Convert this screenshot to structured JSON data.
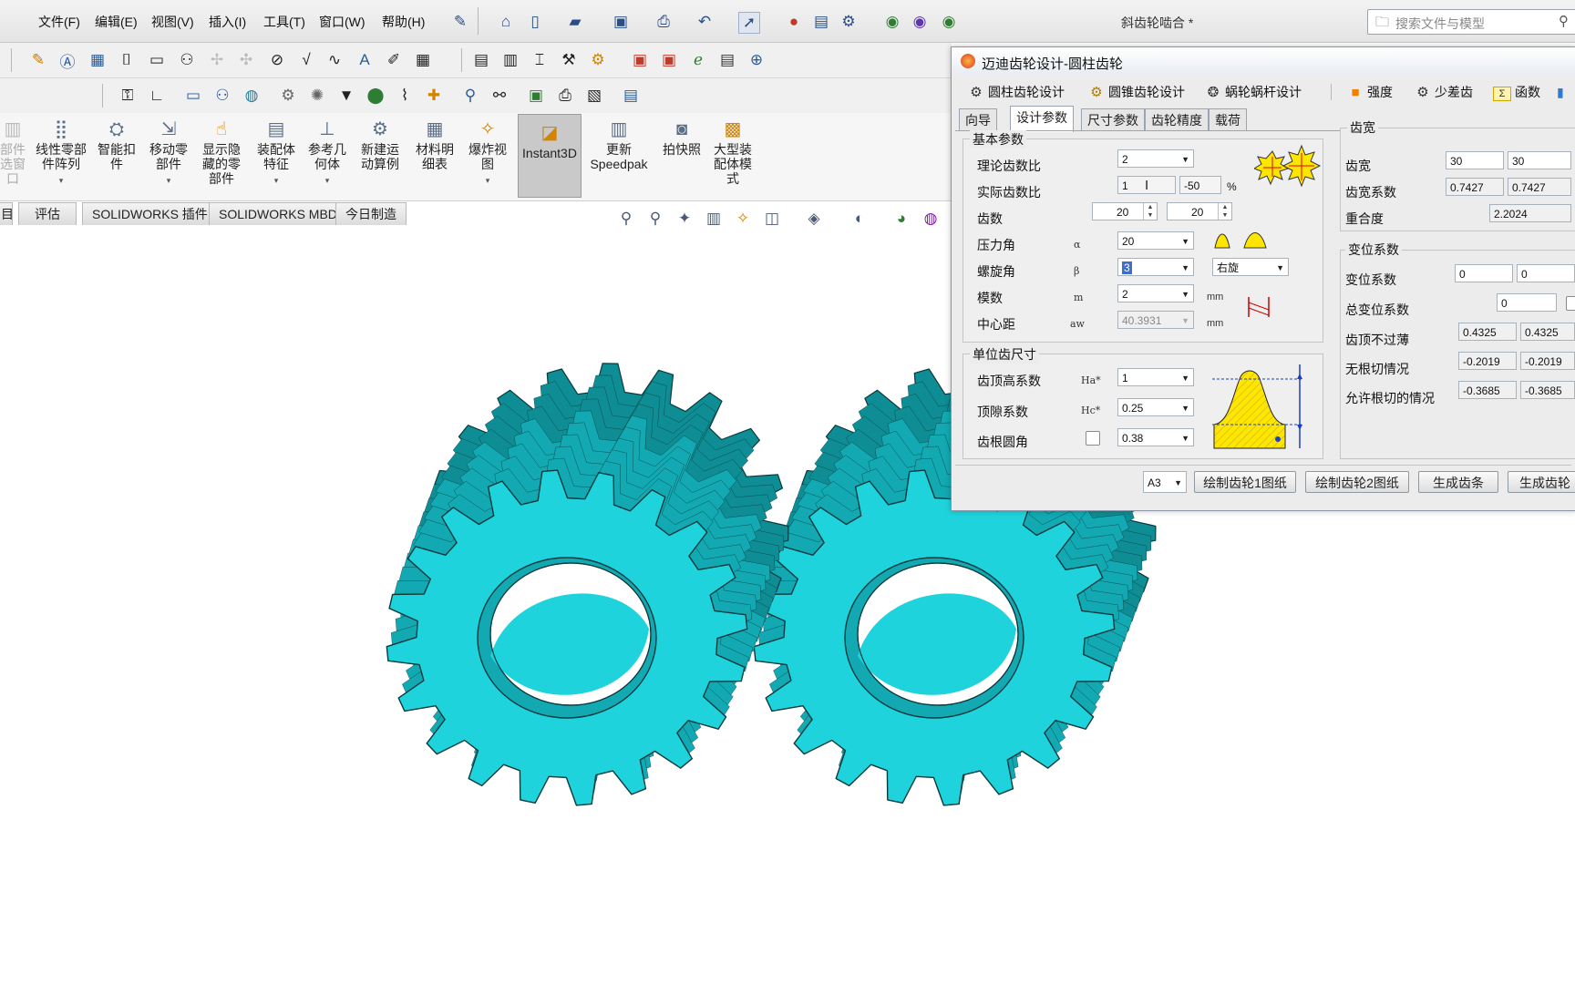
{
  "menu": [
    "文件(F)",
    "编辑(E)",
    "视图(V)",
    "插入(I)",
    "工具(T)",
    "窗口(W)",
    "帮助(H)"
  ],
  "document_title": "斜齿轮啮合 *",
  "search": {
    "placeholder": "搜索文件与模型"
  },
  "command_manager": {
    "items": [
      {
        "label": "部件\n选窗\n口",
        "icon": "component-icon",
        "disabled": true
      },
      {
        "label": "线性零部\n件阵列",
        "icon": "linear-pattern-icon"
      },
      {
        "label": "智能扣\n件",
        "icon": "smart-fastener-icon"
      },
      {
        "label": "移动零\n部件",
        "icon": "move-component-icon"
      },
      {
        "label": "显示隐\n藏的零\n部件",
        "icon": "show-hidden-icon"
      },
      {
        "label": "装配体\n特征",
        "icon": "assembly-feature-icon"
      },
      {
        "label": "参考几\n何体",
        "icon": "reference-geometry-icon"
      },
      {
        "label": "新建运\n动算例",
        "icon": "motion-study-icon"
      },
      {
        "label": "材料明\n细表",
        "icon": "bom-icon"
      },
      {
        "label": "爆炸视\n图",
        "icon": "exploded-view-icon"
      },
      {
        "label": "Instant3D",
        "icon": "instant3d-icon",
        "active": true
      },
      {
        "label": "更新\nSpeedpak",
        "icon": "speedpak-icon"
      },
      {
        "label": "拍快照",
        "icon": "snapshot-icon"
      },
      {
        "label": "大型装\n配体模\n式",
        "icon": "large-assembly-icon"
      }
    ]
  },
  "tabs": [
    "目",
    "评估",
    "SOLIDWORKS 插件",
    "SOLIDWORKS MBD",
    "今日制造"
  ],
  "dialog": {
    "title": "迈迪齿轮设计-圆柱齿轮",
    "top_tabs": [
      {
        "label": "圆柱齿轮设计",
        "icon": "gear-icon"
      },
      {
        "label": "圆锥齿轮设计",
        "icon": "bevel-gear-icon"
      },
      {
        "label": "蜗轮蜗杆设计",
        "icon": "worm-gear-icon"
      },
      {
        "label": "强度",
        "icon": "strength-icon"
      },
      {
        "label": "少差齿",
        "icon": "small-diff-gear-icon"
      },
      {
        "label": "函数",
        "icon": "function-icon"
      }
    ],
    "page_tabs": [
      "向导",
      "设计参数",
      "尺寸参数",
      "齿轮精度",
      "载荷"
    ],
    "basic": {
      "title": "基本参数",
      "ratio_label": "理论齿数比",
      "ratio_value": "2",
      "actual_ratio_label": "实际齿数比",
      "actual_ratio_value": "1",
      "actual_ratio_pct": "-50",
      "pct_unit": "%",
      "teeth_label": "齿数",
      "teeth1": "20",
      "teeth2": "20",
      "pressure_label": "压力角",
      "pressure_sym": "α",
      "pressure_value": "20",
      "helix_label": "螺旋角",
      "helix_sym": "β",
      "helix_value": "3",
      "helix_dir": "右旋",
      "module_label": "模数",
      "module_sym": "m",
      "module_value": "2",
      "module_unit": "mm",
      "center_label": "中心距",
      "center_sym": "aw",
      "center_value": "40.3931",
      "center_unit": "mm"
    },
    "unit": {
      "title": "单位齿尺寸",
      "addendum_label": "齿顶高系数",
      "addendum_sym": "Ha*",
      "addendum_value": "1",
      "clearance_label": "顶隙系数",
      "clearance_sym": "Hc*",
      "clearance_value": "0.25",
      "fillet_label": "齿根圆角",
      "fillet_value": "0.38"
    },
    "width": {
      "title": "齿宽",
      "width_label": "齿宽",
      "w1": "30",
      "w2": "30",
      "coef_label": "齿宽系数",
      "c1": "0.7427",
      "c2": "0.7427",
      "overlap_label": "重合度",
      "overlap": "2.2024"
    },
    "shift": {
      "title": "变位系数",
      "shift_label": "变位系数",
      "s1": "0",
      "s2": "0",
      "total_label": "总变位系数",
      "total": "0",
      "tip_label": "齿顶不过薄",
      "t1": "0.4325",
      "t2": "0.4325",
      "nocut_label": "无根切情况",
      "n1": "-0.2019",
      "n2": "-0.2019",
      "allow_label": "允许根切的情况",
      "a1": "-0.3685",
      "a2": "-0.3685"
    },
    "bottom": {
      "paper": "A3",
      "btn1": "绘制齿轮1图纸",
      "btn2": "绘制齿轮2图纸",
      "btn3": "生成齿条",
      "btn4": "生成齿轮"
    }
  },
  "colors": {
    "gear": "#1fd3dd",
    "gear_dark": "#12a9b2",
    "gear_shadow": "#0e8d94",
    "edge": "#0b3a3d"
  }
}
